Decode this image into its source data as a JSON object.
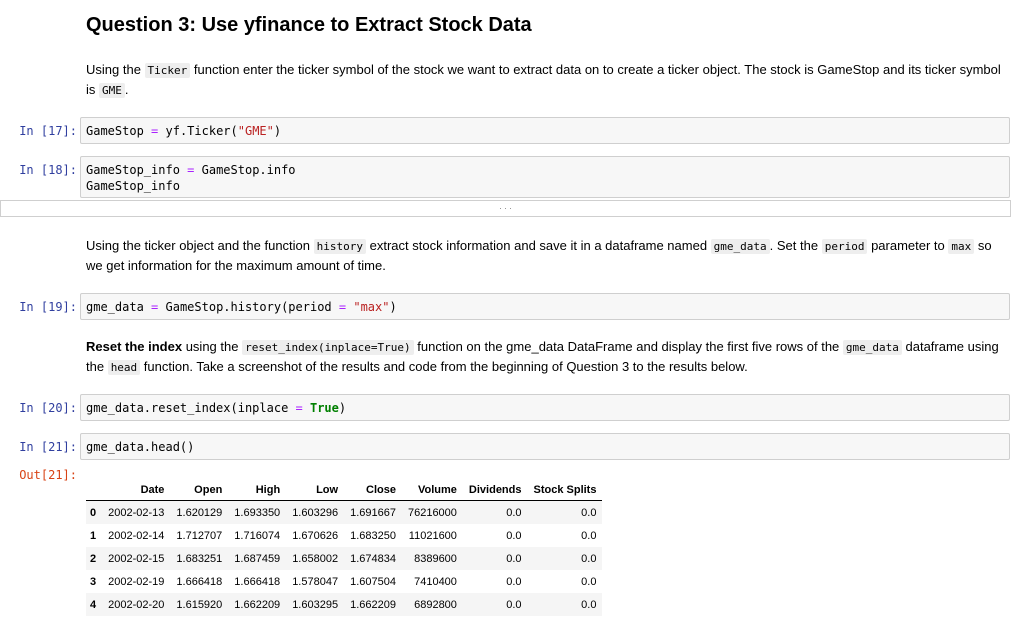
{
  "heading": "Question 3: Use yfinance to Extract Stock Data",
  "md1": {
    "t1": "Using the ",
    "c1": "Ticker",
    "t2": " function enter the ticker symbol of the stock we want to extract data on to create a ticker object. The stock is GameStop and its ticker symbol is ",
    "c2": "GME",
    "t3": "."
  },
  "cells": {
    "c17": {
      "prompt": "In [17]:",
      "a": "GameStop ",
      "b": "=",
      "c": " yf.Ticker(",
      "d": "\"GME\"",
      "e": ")"
    },
    "c18": {
      "prompt": "In [18]:",
      "l1a": "GameStop_info ",
      "l1b": "=",
      "l1c": " GameStop.info",
      "l2": "GameStop_info"
    },
    "c19": {
      "prompt": "In [19]:",
      "a": "gme_data ",
      "b": "=",
      "c": " GameStop.history(period ",
      "d": "=",
      "e": " ",
      "f": "\"max\"",
      "g": ")"
    },
    "c20": {
      "prompt": "In [20]:",
      "a": "gme_data.reset_index(inplace ",
      "b": "=",
      "c": " ",
      "d": "True",
      "e": ")"
    },
    "c21": {
      "prompt": "In [21]:",
      "a": "gme_data.head()",
      "out": "Out[21]:"
    }
  },
  "collapsed_text": ". . .",
  "md2": {
    "t1": "Using the ticker object and the function ",
    "c1": "history",
    "t2": " extract stock information and save it in a dataframe named ",
    "c2": "gme_data",
    "t3": ". Set the ",
    "c3": "period",
    "t4": " parameter to ",
    "c4": "max",
    "t5": " so we get information for the maximum amount of time."
  },
  "md3": {
    "b1": "Reset the index",
    "t1": " using the ",
    "c1": "reset_index(inplace=True)",
    "t2": " function on the gme_data DataFrame and display the first five rows of the ",
    "c2": "gme_data",
    "t3": " dataframe using the ",
    "c3": "head",
    "t4": " function. Take a screenshot of the results and code from the beginning of Question 3 to the results below."
  },
  "table": {
    "columns": [
      "",
      "Date",
      "Open",
      "High",
      "Low",
      "Close",
      "Volume",
      "Dividends",
      "Stock Splits"
    ],
    "rows": [
      [
        "0",
        "2002-02-13",
        "1.620129",
        "1.693350",
        "1.603296",
        "1.691667",
        "76216000",
        "0.0",
        "0.0"
      ],
      [
        "1",
        "2002-02-14",
        "1.712707",
        "1.716074",
        "1.670626",
        "1.683250",
        "11021600",
        "0.0",
        "0.0"
      ],
      [
        "2",
        "2002-02-15",
        "1.683251",
        "1.687459",
        "1.658002",
        "1.674834",
        "8389600",
        "0.0",
        "0.0"
      ],
      [
        "3",
        "2002-02-19",
        "1.666418",
        "1.666418",
        "1.578047",
        "1.607504",
        "7410400",
        "0.0",
        "0.0"
      ],
      [
        "4",
        "2002-02-20",
        "1.615920",
        "1.662209",
        "1.603295",
        "1.662209",
        "6892800",
        "0.0",
        "0.0"
      ]
    ]
  }
}
